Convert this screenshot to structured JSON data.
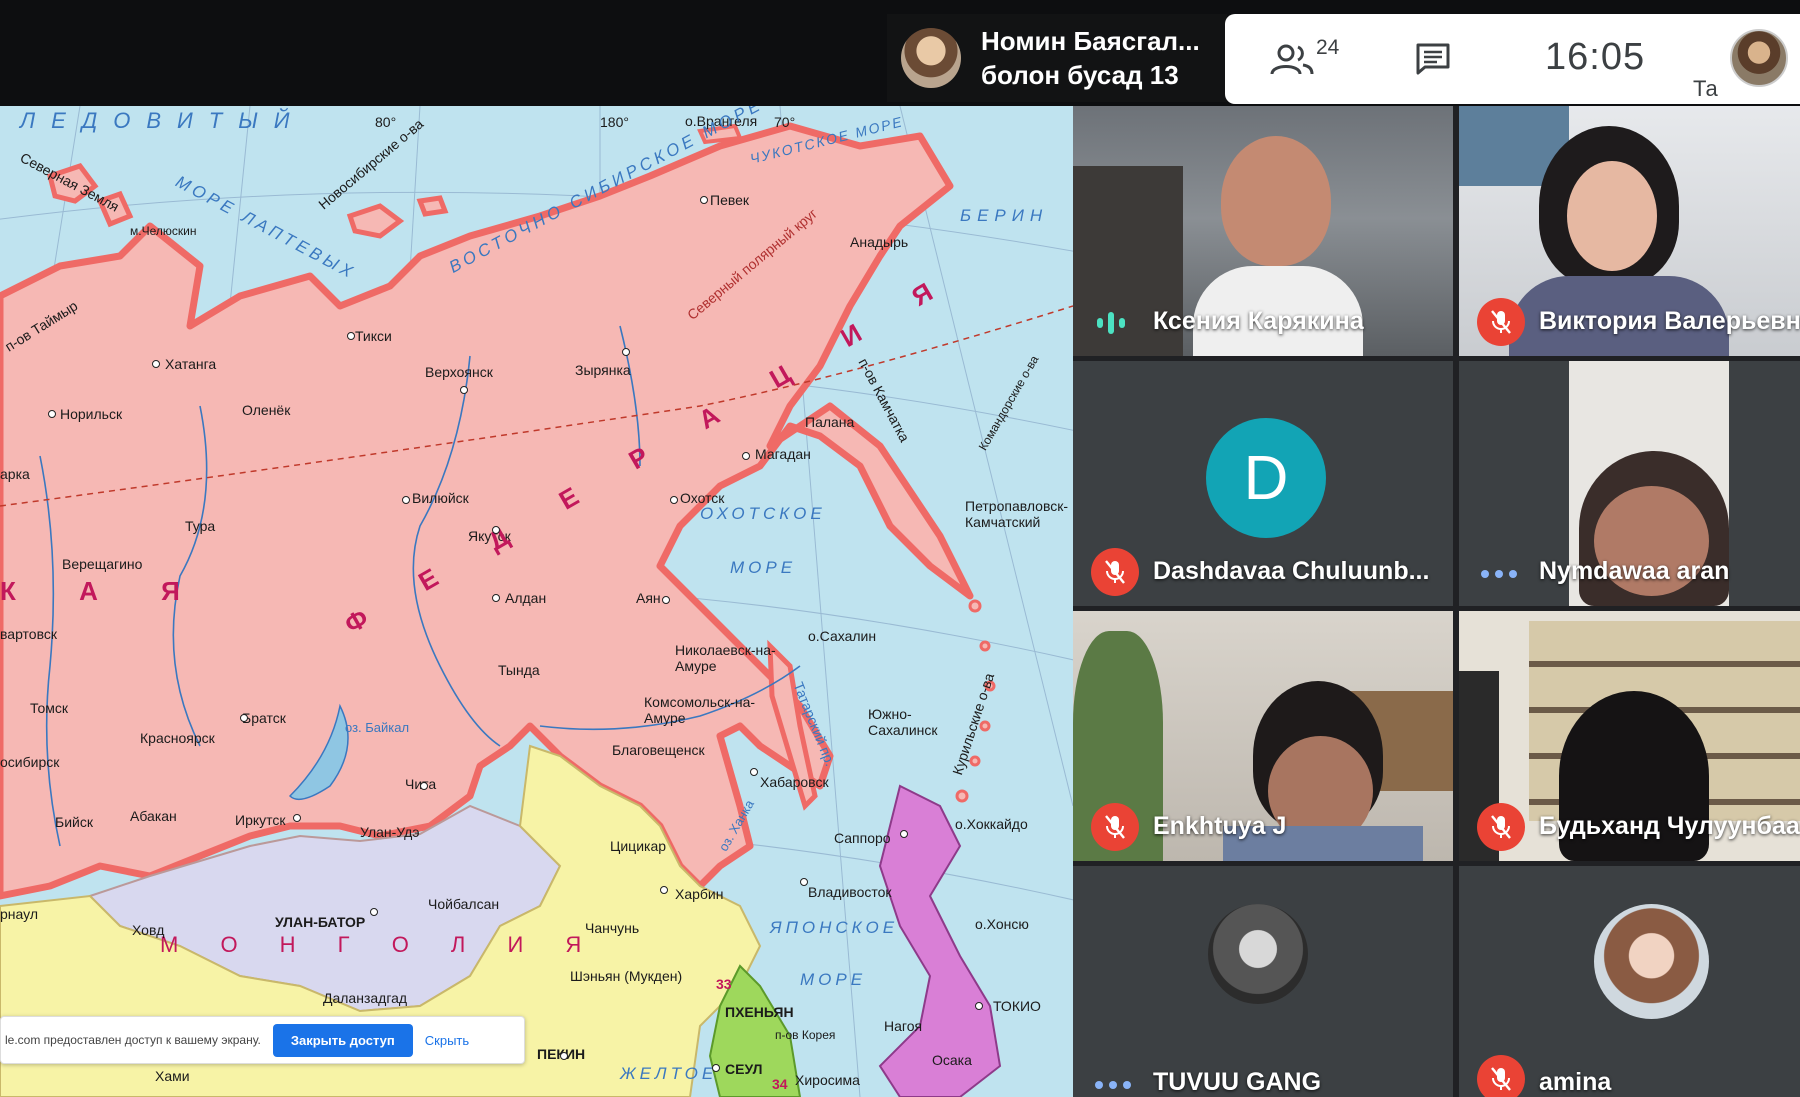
{
  "meeting": {
    "presenter_line1": "Номин Баясгал...",
    "presenter_line2": "болон бусад 13",
    "people_count": "24",
    "clock": "16:05",
    "you_label": "Та"
  },
  "share_bar": {
    "text": "le.com предоставлен доступ к вашему экрану.",
    "stop_label": "Закрыть доступ",
    "hide_label": "Скрыть"
  },
  "map": {
    "country_label_1": "Ф Е Д Е Р А Ц И Я",
    "country_label_2": "К А Я",
    "mongolia_label": "М О Н Г О Л И Я",
    "seas": {
      "laptev": "МОРЕ ЛАПТЕВЫХ",
      "east_siberian": "ВОСТОЧНО СИБИРСКОЕ МОРЕ",
      "okhotsk_1": "ОХОТСКОЕ",
      "okhotsk_2": "МОРЕ",
      "japan_1": "ЯПОНСКОЕ",
      "japan_2": "МОРЕ",
      "chukchi": "ЧУКОТСКОЕ МОРЕ",
      "arctic": "ЛЕДОВИТЫЙ",
      "bering": "БЕРИН",
      "yellow": "ЖЕЛТОЕ"
    },
    "cities": {
      "tiksi": "Тикси",
      "khatanga": "Хатанга",
      "verkhoyansk": "Верхоянск",
      "zyryanka": "Зырянка",
      "pevek": "Певек",
      "anadyr": "Анадырь",
      "norilsk": "Норильск",
      "olenyok": "Оленёк",
      "magadan": "Магадан",
      "palana": "Палана",
      "vilyuysk": "Вилюйск",
      "yakutsk": "Якутск",
      "okhotsk": "Охотск",
      "tura": "Тура",
      "vereshchagino": "Верещагино",
      "aldan": "Алдан",
      "ayan": "Аян",
      "tynda": "Тында",
      "nikolaevsk": "Николаевск-на-Амуре",
      "komsomolsk": "Комсомольск-на-Амуре",
      "tomsk": "Томск",
      "bratsk": "Братск",
      "krasnoyarsk": "Красноярск",
      "blagoveshchensk": "Благовещенск",
      "khabarovsk": "Хабаровск",
      "chita": "Чита",
      "abakan": "Абакан",
      "irkutsk": "Иркутск",
      "ulan_ude": "Улан-Удэ",
      "biysk": "Бийск",
      "petropavlovsk": "Петропавловск-Камчатский",
      "yuzhno": "Южно-Сахалинск",
      "ulaanbaatar": "УЛАН-БАТОР",
      "khovd": "Ховд",
      "choibalsan": "Чойбалсан",
      "dalanzadgad": "Даланзадгад",
      "qiqihar": "Цицикар",
      "harbin": "Харбин",
      "changchun": "Чанчунь",
      "shenyang": "Шэньян (Мукден)",
      "pyongyang": "ПХЕНЬЯН",
      "seoul": "СЕУЛ",
      "beijing": "ПЕКИН",
      "vladivostok": "Владивосток",
      "sapporo": "Саппоро",
      "tokyo": "ТОКИО",
      "osaka": "Осака",
      "nagoya": "Нагоя",
      "hiroshima": "Хиросима",
      "hami": "Хами",
      "novosibirsk": "осибирск",
      "barnaul": "рнаул",
      "nizhnevartovsk": "вартовск",
      "igarka": "арка",
      "chelyuskin": "м.Челюскин"
    },
    "regions": {
      "taimyr": "п-ов Таймыр",
      "severnaya_zemlya": "Северная Земля",
      "novosib_islands": "Новосибирские о-ва",
      "wrangel": "о.Врангеля",
      "kamchatka": "п-ов Камчатка",
      "sakhalin": "о.Сахалин",
      "hokkaido": "о.Хоккайдо",
      "honshu": "о.Хонсю",
      "kuril": "Курильские о-ва",
      "arctic_circle": "Северный полярный круг",
      "korea_pen": "п-ов Корея",
      "khanka": "оз. Ханка",
      "baikal": "оз. Байкал",
      "tatar": "Татарский пр.",
      "commander": "Командорские о-ва"
    },
    "degrees": {
      "d80": "80°",
      "d180": "180°",
      "d70": "70°"
    },
    "badge_33": "33",
    "badge_34": "34"
  },
  "participants": [
    {
      "name": "Ксения Карякина",
      "state": "speaking"
    },
    {
      "name": "Виктория Валерьевн",
      "state": "muted"
    },
    {
      "name": "Dashdavaa Chuluunb...",
      "state": "muted",
      "initial": "D"
    },
    {
      "name": "Nymdawaa aran",
      "state": "more"
    },
    {
      "name": "Enkhtuya J",
      "state": "muted"
    },
    {
      "name": "Будьханд Чулуунбаа",
      "state": "muted"
    },
    {
      "name": "TUVUU GANG",
      "state": "more"
    },
    {
      "name": "amina",
      "state": "muted"
    }
  ],
  "colors": {
    "russia": "#f6b8b4",
    "russia_border": "#ef6a66",
    "mongolia": "#d8d8ef",
    "china": "#f7f3a6",
    "japan": "#d97fd6",
    "sea": "#bfe3ef",
    "mute_red": "#ea4335",
    "avatar_teal": "#12a4b5",
    "share_blue": "#1a73e8"
  }
}
